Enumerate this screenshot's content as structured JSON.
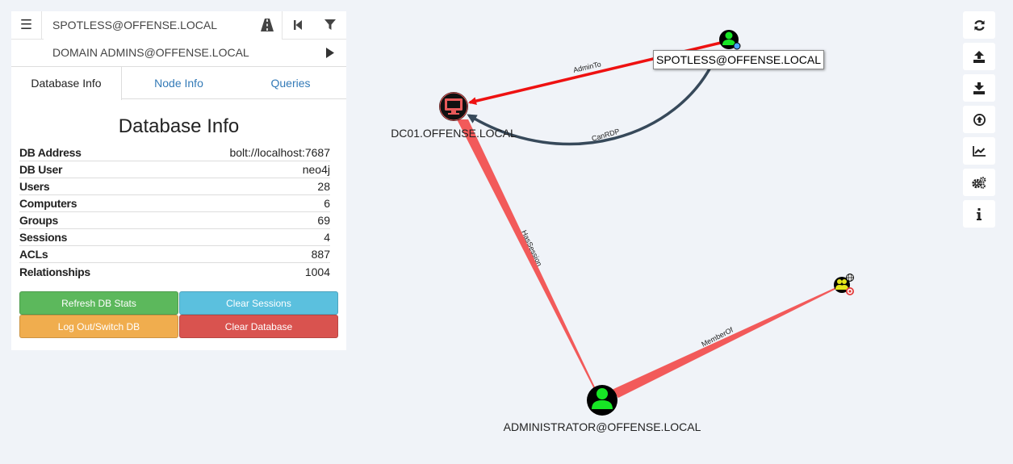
{
  "search": {
    "start_node": "SPOTLESS@OFFENSE.LOCAL",
    "target_node": "DOMAIN ADMINS@OFFENSE.LOCAL"
  },
  "tabs": [
    {
      "label": "Database Info"
    },
    {
      "label": "Node Info"
    },
    {
      "label": "Queries"
    }
  ],
  "db_info": {
    "title": "Database Info",
    "rows": [
      {
        "key": "DB Address",
        "value": "bolt://localhost:7687"
      },
      {
        "key": "DB User",
        "value": "neo4j"
      },
      {
        "key": "Users",
        "value": "28"
      },
      {
        "key": "Computers",
        "value": "6"
      },
      {
        "key": "Groups",
        "value": "69"
      },
      {
        "key": "Sessions",
        "value": "4"
      },
      {
        "key": "ACLs",
        "value": "887"
      },
      {
        "key": "Relationships",
        "value": "1004"
      }
    ]
  },
  "buttons": {
    "refresh": "Refresh DB Stats",
    "clear_sessions": "Clear Sessions",
    "logout": "Log Out/Switch DB",
    "clear_database": "Clear Database"
  },
  "colors": {
    "refresh": "#4cae4c",
    "clear_sessions": "#46b8da",
    "logout": "#eea236",
    "clear_database": "#d43f3a",
    "edge_red": "#ee1111",
    "edge_session": "#f25a5a",
    "edge_rdp": "#37495a",
    "user_node": "#17e625"
  },
  "toolbar_icons": [
    "refresh-icon",
    "upload-icon",
    "download-icon",
    "import-icon",
    "chart-icon",
    "settings-icon",
    "info-icon"
  ],
  "graph": {
    "nodes": {
      "dc": "DC01.OFFENSE.LOCAL",
      "spotless": "SPOTLESS@OFFENSE.LOCAL",
      "administrator": "ADMINISTRATOR@OFFENSE.LOCAL"
    },
    "edges": {
      "admin_to": "AdminTo",
      "can_rdp": "CanRDP",
      "has_session": "HasSession",
      "member_of": "MemberOf"
    },
    "tooltip": "SPOTLESS@OFFENSE.LOCAL"
  }
}
